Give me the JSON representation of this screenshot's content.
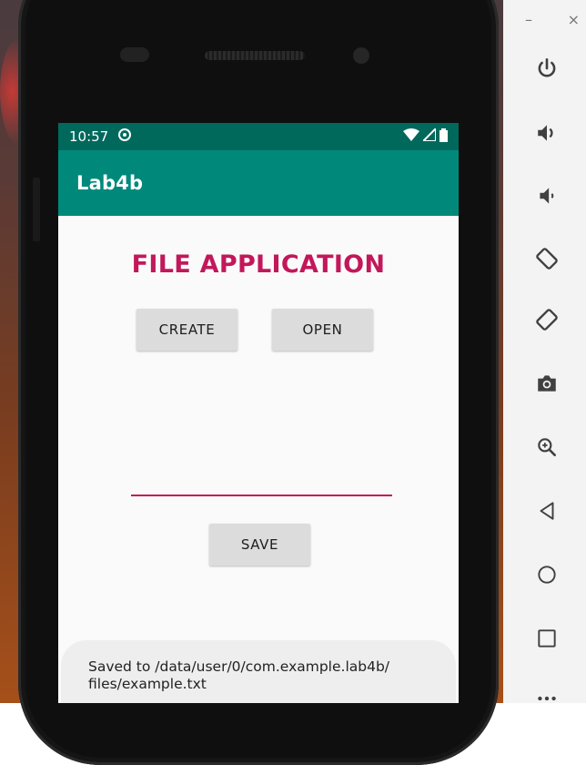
{
  "status_bar": {
    "time": "10:57"
  },
  "app": {
    "title": "Lab4b",
    "heading": "FILE APPLICATION",
    "buttons": {
      "create": "CREATE",
      "open": "OPEN",
      "save": "SAVE"
    },
    "input": {
      "value": "",
      "placeholder": ""
    },
    "toast": {
      "line1": "Saved to /data/user/0/com.example.lab4b/",
      "line2": "files/example.txt"
    }
  },
  "emulator_toolbar": {
    "minimize": "–",
    "close": "×",
    "tools": [
      "power-icon",
      "volume-up-icon",
      "volume-down-icon",
      "rotate-left-icon",
      "rotate-right-icon",
      "camera-icon",
      "zoom-icon",
      "back-icon",
      "home-icon",
      "overview-icon",
      "more-icon"
    ]
  },
  "colors": {
    "status_bar": "#00695c",
    "app_bar": "#00897b",
    "accent": "#c2185b",
    "button": "#dcdcdc"
  }
}
